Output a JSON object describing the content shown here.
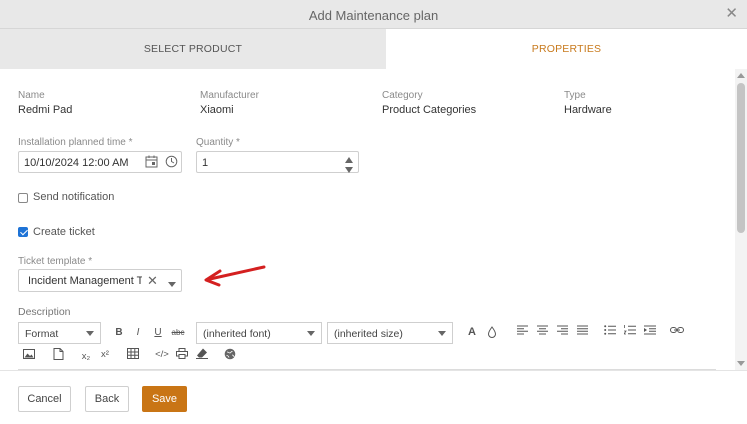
{
  "dialog": {
    "title": "Add Maintenance plan"
  },
  "tabs": [
    {
      "label": "SELECT PRODUCT"
    },
    {
      "label": "PROPERTIES"
    }
  ],
  "product": {
    "name_label": "Name",
    "name": "Redmi Pad",
    "manufacturer_label": "Manufacturer",
    "manufacturer": "Xiaomi",
    "category_label": "Category",
    "category": "Product Categories",
    "type_label": "Type",
    "type": "Hardware"
  },
  "form": {
    "installation_label": "Installation planned time *",
    "installation_value": "10/10/2024 12:00 AM",
    "quantity_label": "Quantity *",
    "quantity_value": "1",
    "send_notification_label": "Send notification",
    "send_notification_checked": false,
    "create_ticket_label": "Create ticket",
    "create_ticket_checked": true,
    "ticket_template_label": "Ticket template *",
    "ticket_template_value": "Incident Management Ti",
    "description_label": "Description"
  },
  "editor": {
    "format": "Format",
    "font": "(inherited font)",
    "size": "(inherited size)",
    "bold": "B",
    "italic": "I",
    "underline": "U",
    "strike": "abc",
    "subscript": "x₂",
    "superscript": "x²",
    "code": "</>"
  },
  "footer": {
    "cancel": "Cancel",
    "back": "Back",
    "save": "Save"
  },
  "colors": {
    "accent": "#c97515",
    "tab_active": "#c87a1d",
    "checkbox": "#1e73d6",
    "annotation_arrow": "#d42020"
  }
}
